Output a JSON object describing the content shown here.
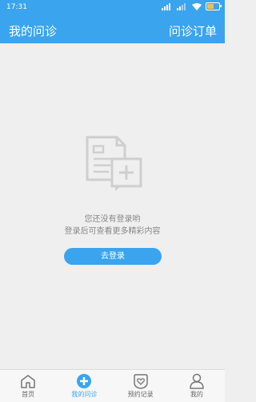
{
  "status_bar": {
    "time": "17:31",
    "battery_level": "59"
  },
  "header": {
    "title": "我的问诊",
    "right_action": "问诊订单"
  },
  "empty_state": {
    "line1": "您还没有登录哟",
    "line2": "登录后可查看更多精彩内容",
    "button_label": "去登录"
  },
  "tabs": [
    {
      "label": "首页",
      "icon": "home-icon"
    },
    {
      "label": "我的问诊",
      "icon": "plus-circle-icon",
      "active": true
    },
    {
      "label": "预约记录",
      "icon": "heart-shield-icon"
    },
    {
      "label": "我的",
      "icon": "user-icon"
    }
  ],
  "colors": {
    "accent": "#3aa4ef",
    "background": "#efefef"
  }
}
